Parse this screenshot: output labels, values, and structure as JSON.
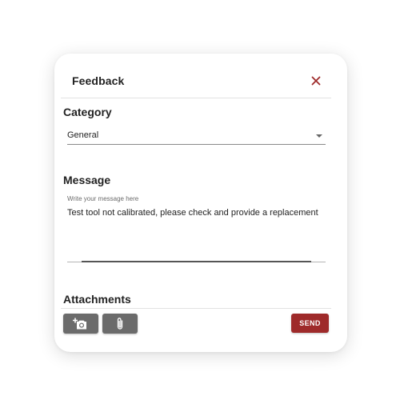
{
  "dialog": {
    "title": "Feedback",
    "close_icon": "close-icon"
  },
  "category": {
    "label": "Category",
    "selected_value": "General"
  },
  "message": {
    "label": "Message",
    "field_label": "Write your message here",
    "value": "Test tool not calibrated, please check and provide a replacement"
  },
  "attachments": {
    "label": "Attachments",
    "buttons": [
      {
        "icon": "add-photo-icon"
      },
      {
        "icon": "paperclip-icon"
      }
    ]
  },
  "actions": {
    "send_label": "SEND"
  },
  "colors": {
    "accent": "#9e2a2a",
    "secondary_button": "#6b6b6b"
  }
}
